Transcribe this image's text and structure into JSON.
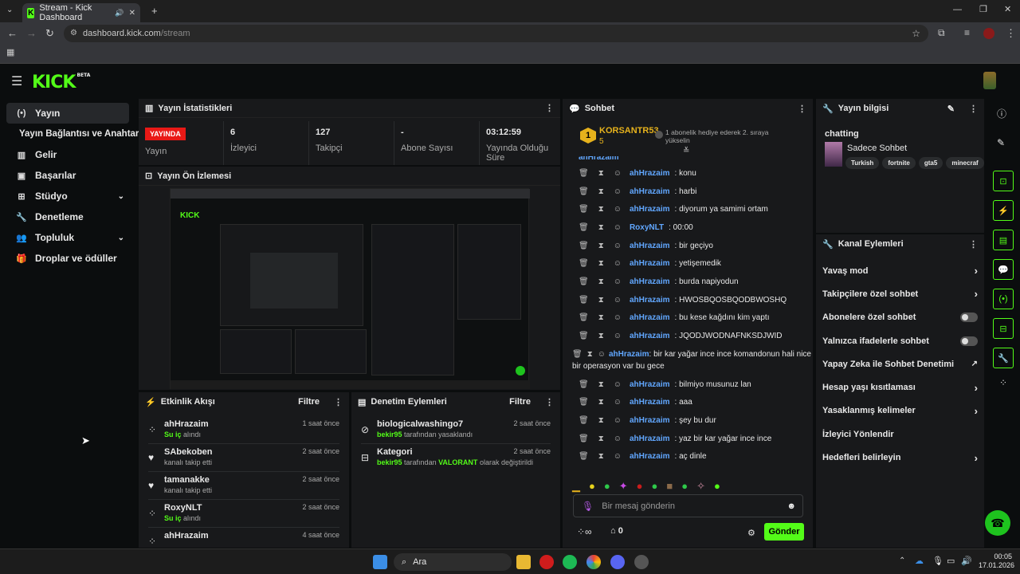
{
  "browser": {
    "tab_title": "Stream - Kick Dashboard",
    "url_domain": "dashboard.kick.com",
    "url_path": "/stream"
  },
  "app": {
    "logo": "KICK",
    "logo_beta": "BETA"
  },
  "sidebar": {
    "items": [
      {
        "label": "Yayın",
        "icon": "broadcast-icon"
      },
      {
        "label": "Yayın Bağlantısı ve Anahtarı",
        "icon": ""
      },
      {
        "label": "Gelir",
        "icon": "chart-icon"
      },
      {
        "label": "Başarılar",
        "icon": "trophy-icon"
      },
      {
        "label": "Stüdyo",
        "icon": "grid-icon"
      },
      {
        "label": "Denetleme",
        "icon": "wrench-icon"
      },
      {
        "label": "Topluluk",
        "icon": "people-icon"
      },
      {
        "label": "Droplar ve ödüller",
        "icon": "gift-icon"
      }
    ]
  },
  "stats": {
    "title": "Yayın İstatistikleri",
    "live_badge": "YAYINDA",
    "live_label": "Yayın",
    "viewers": "6",
    "viewers_label": "İzleyici",
    "followers": "127",
    "followers_label": "Takipçi",
    "subs": "-",
    "subs_label": "Abone Sayısı",
    "uptime": "03:12:59",
    "uptime_label": "Yayında Olduğu Süre"
  },
  "preview": {
    "title": "Yayın Ön İzlemesi"
  },
  "activity": {
    "title": "Etkinlik Akışı",
    "filter": "Filtre",
    "items": [
      {
        "name": "ahHrazaim",
        "sub": "Su iç",
        "sub2": "alındı",
        "time": "1 saat önce"
      },
      {
        "name": "SAbekoben",
        "sub": "kanalı takip etti",
        "sub2": "",
        "time": "2 saat önce"
      },
      {
        "name": "tamanakke",
        "sub": "kanalı takip etti",
        "sub2": "",
        "time": "2 saat önce"
      },
      {
        "name": "RoxyNLT",
        "sub": "Su iç",
        "sub2": "alındı",
        "time": "2 saat önce"
      },
      {
        "name": "ahHrazaim",
        "sub": "",
        "sub2": "",
        "time": "4 saat önce"
      }
    ]
  },
  "moderation": {
    "title": "Denetim Eylemleri",
    "filter": "Filtre",
    "items": [
      {
        "name": "biologicalwashingo7",
        "by": "bekir95",
        "text": "tarafından yasaklandı",
        "extra": "",
        "time": "2 saat önce"
      },
      {
        "name": "Kategori",
        "by": "bekir95",
        "text": "tarafından",
        "extra": "VALORANT",
        "text2": "olarak değiştirildi",
        "time": "2 saat önce"
      }
    ]
  },
  "chat": {
    "title": "Sohbet",
    "pinned_user": "KORSANTR53",
    "pinned_count": "5",
    "pinned_badge": "1",
    "pinned_msg": "1 abonelik hediye ederek 2. sıraya yükselin",
    "messages": [
      {
        "user": "ahHrazaim",
        "text": "konu"
      },
      {
        "user": "ahHrazaim",
        "text": "harbi"
      },
      {
        "user": "ahHrazaim",
        "text": "diyorum ya samimi ortam"
      },
      {
        "user": "RoxyNLT",
        "text": "00:00"
      },
      {
        "user": "ahHrazaim",
        "text": "bir geçiyo"
      },
      {
        "user": "ahHrazaim",
        "text": "yetişemedik"
      },
      {
        "user": "ahHrazaim",
        "text": "burda napiyodun"
      },
      {
        "user": "ahHrazaim",
        "text": "HWOSBQOSBQODBWOSHQ"
      },
      {
        "user": "ahHrazaim",
        "text": "bu kese kağdını kim yaptı"
      },
      {
        "user": "ahHrazaim",
        "text": "JQODJWODNAFNKSDJWID"
      },
      {
        "user": "ahHrazaim",
        "text": "bir kar yağar ince ince komandonun hali nice bir operasyon var bu gece"
      },
      {
        "user": "ahHrazaim",
        "text": "bilmiyo musunuz lan"
      },
      {
        "user": "ahHrazaim",
        "text": "aaa"
      },
      {
        "user": "ahHrazaim",
        "text": "şey bu dur"
      },
      {
        "user": "ahHrazaim",
        "text": "yaz bir kar yağar ince ince"
      },
      {
        "user": "ahHrazaim",
        "text": "aç dinle"
      }
    ],
    "top_partial": "ahHrazaim",
    "placeholder": "Bir mesaj gönderin",
    "send": "Gönder",
    "points": "0"
  },
  "stream_info": {
    "title": "Yayın bilgisi",
    "stream_title": "chatting",
    "category": "Sadece Sohbet",
    "tags": [
      "Turkish",
      "fortnite",
      "gta5",
      "minecraf"
    ]
  },
  "channel_actions": {
    "title": "Kanal Eylemleri",
    "items": [
      {
        "label": "Yavaş mod",
        "type": "chevron"
      },
      {
        "label": "Takipçilere özel sohbet",
        "type": "chevron"
      },
      {
        "label": "Abonelere özel sohbet",
        "type": "toggle"
      },
      {
        "label": "Yalnızca ifadelerle sohbet",
        "type": "toggle"
      },
      {
        "label": "Yapay Zeka ile Sohbet Denetimi",
        "type": "external"
      },
      {
        "label": "Hesap yaşı kısıtlaması",
        "type": "chevron"
      },
      {
        "label": "Yasaklanmış kelimeler",
        "type": "chevron"
      },
      {
        "label": "İzleyici Yönlendir",
        "type": "none"
      },
      {
        "label": "Hedefleri belirleyin",
        "type": "chevron"
      }
    ]
  },
  "taskbar": {
    "search": "Ara",
    "time": "00:05",
    "date": "17.01.2026"
  }
}
